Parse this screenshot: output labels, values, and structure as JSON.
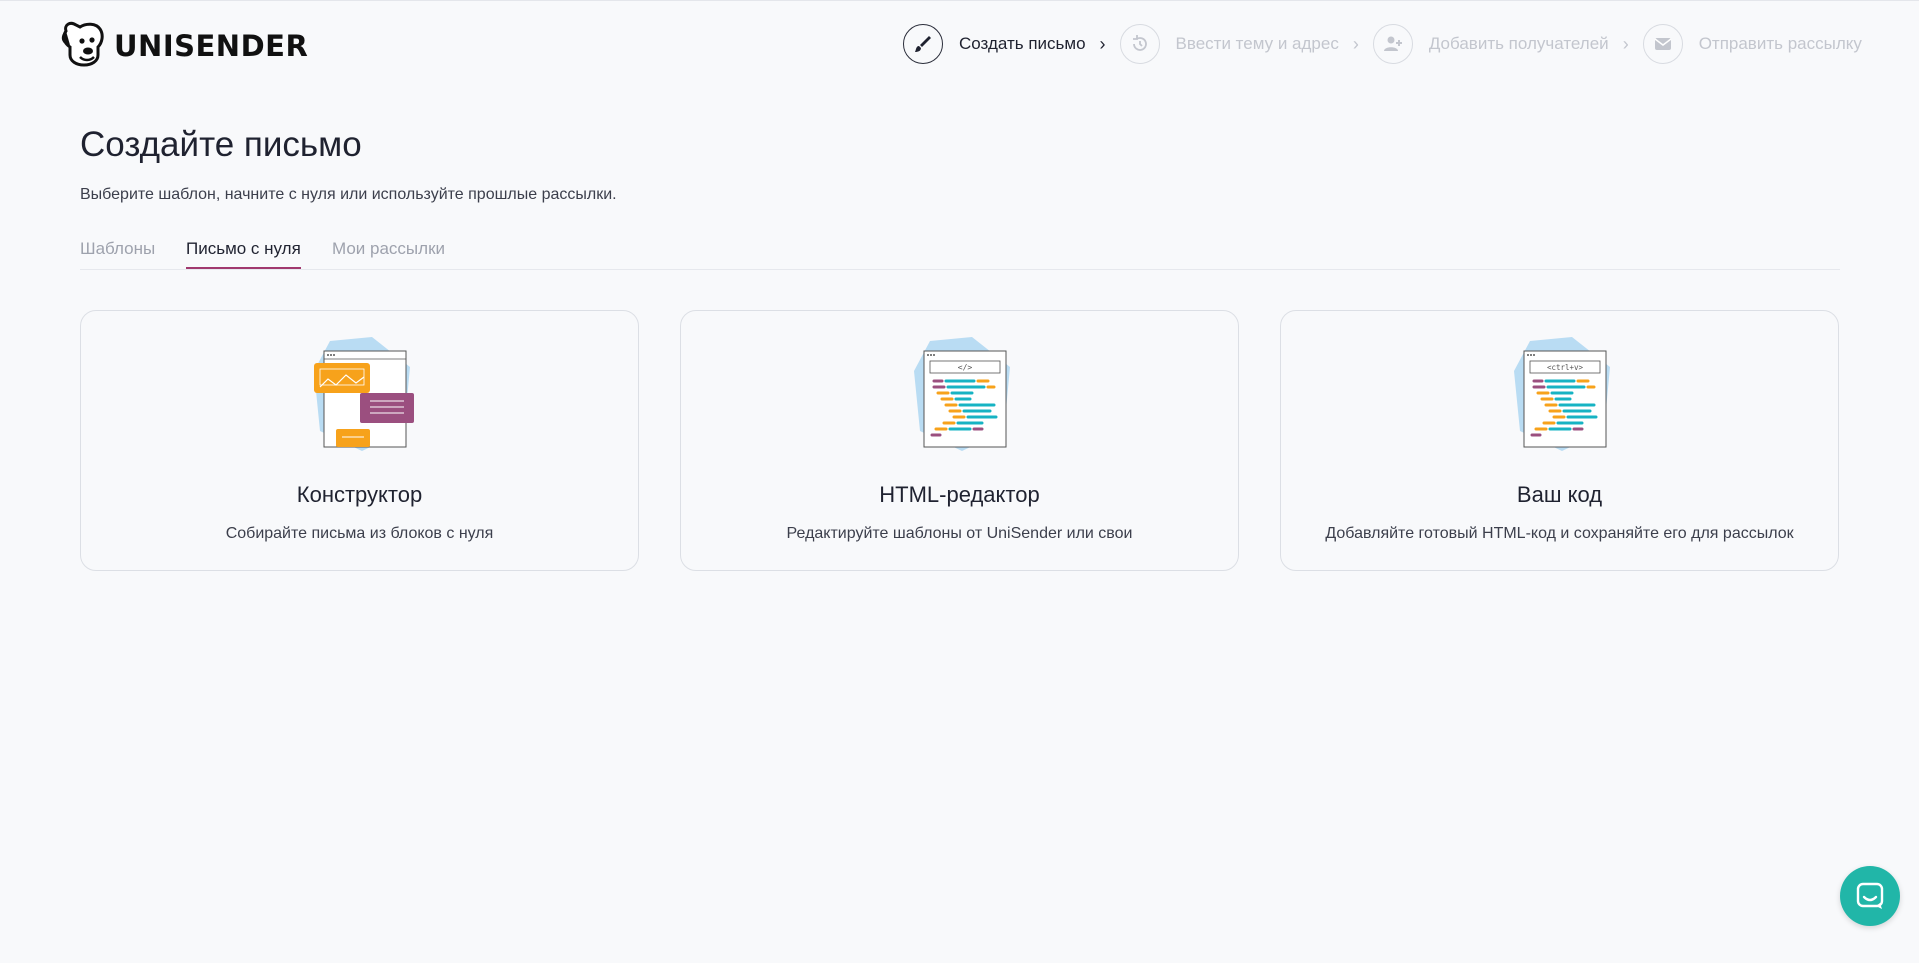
{
  "brand": {
    "name": "UNISENDER"
  },
  "steps": [
    {
      "label": "Создать письмо",
      "icon": "brush-icon",
      "active": true
    },
    {
      "label": "Ввести тему и адрес",
      "icon": "history-icon",
      "active": false
    },
    {
      "label": "Добавить получателей",
      "icon": "add-user-icon",
      "active": false
    },
    {
      "label": "Отправить рассылку",
      "icon": "mail-icon",
      "active": false
    }
  ],
  "page": {
    "title": "Создайте письмо",
    "subtitle": "Выберите шаблон, начните с нуля или используйте прошлые рассылки."
  },
  "tabs": [
    {
      "label": "Шаблоны",
      "active": false
    },
    {
      "label": "Письмо с нуля",
      "active": true
    },
    {
      "label": "Мои рассылки",
      "active": false
    }
  ],
  "cards": [
    {
      "title": "Конструктор",
      "description": "Собирайте письма из блоков с нуля",
      "illustration": "constructor-illustration"
    },
    {
      "title": "HTML-редактор",
      "description": "Редактируйте шаблоны от UniSender или свои",
      "illustration": "html-editor-illustration",
      "code_tag": "</>"
    },
    {
      "title": "Ваш код",
      "description": "Добавляйте готовый HTML-код и сохраняйте его для рассылок",
      "illustration": "your-code-illustration",
      "code_tag": "<ctrl+v>"
    }
  ],
  "colors": {
    "accent": "#a0386e",
    "chat": "#21b6a8",
    "illus_blue": "#b9dcf3",
    "illus_orange": "#f7a21b",
    "illus_purple": "#9b4f7f",
    "illus_teal": "#16b3c3"
  },
  "chat_widget": {
    "icon": "chat-icon"
  }
}
